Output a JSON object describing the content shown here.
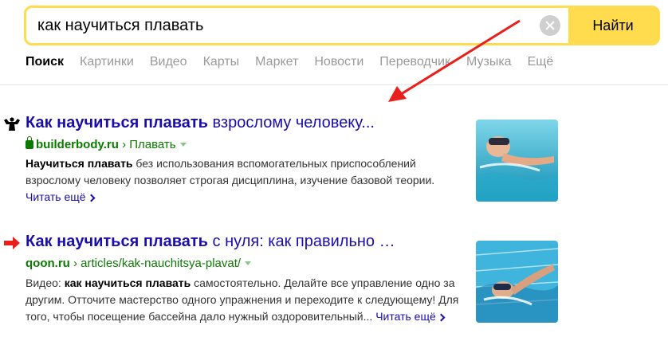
{
  "search": {
    "query": "как научиться плавать",
    "button_label": "Найти"
  },
  "tabs": [
    "Поиск",
    "Картинки",
    "Видео",
    "Карты",
    "Маркет",
    "Новости",
    "Переводчик",
    "Музыка",
    "Ещё"
  ],
  "results": [
    {
      "title_bold": "Как научиться плавать",
      "title_rest": " взрослому человеку...",
      "domain": "builderbody.ru",
      "path": "› Плавать",
      "snippet_bold": "Научиться плавать",
      "snippet_rest": " без использования вспомогательных приспособлений взрослому человеку позволяет строгая дисциплина, изучение базовой теории.",
      "more": "Читать ещё",
      "favicon": "bodybuilder-icon",
      "thumbnail": "swimmer-image"
    },
    {
      "title_bold": "Как научиться плавать",
      "title_rest": " с нуля: как правильно …",
      "domain": "qoon.ru",
      "path": "› articles/kak-nauchitsya-plavat/",
      "snippet_prefix": "Видео: ",
      "snippet_bold": "как научиться плавать",
      "snippet_rest": " самостоятельно. Делайте все управление одно за другим. Отточите мастерство одного упражнения и переходите к следующему! Для того, чтобы посещение бассейна дало нужный оздоровительный...",
      "more": "Читать ещё",
      "favicon": "red-arrow-icon",
      "thumbnail": "swimmer-pool-image"
    }
  ],
  "colors": {
    "accent": "#ffdb4d",
    "link": "#1a0dab",
    "url": "#0b7a00",
    "annotation": "#e8201c"
  }
}
